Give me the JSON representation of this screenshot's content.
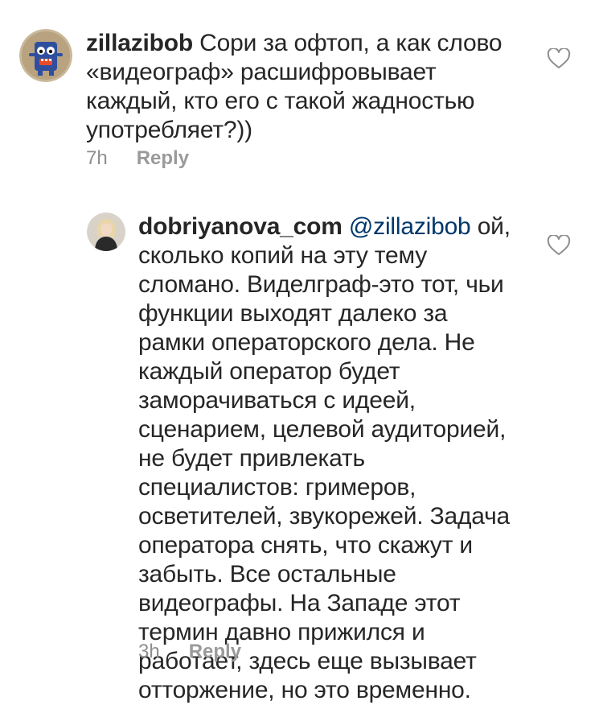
{
  "comments": [
    {
      "username": "zillazibob",
      "text": "Сори за офтоп, а как слово «видеограф» расшифровывает каждый, кто его с такой жадностью употребляет?))",
      "time": "7h",
      "reply_label": "Reply",
      "avatar_icon": "monster-avatar-icon",
      "like_icon": "heart-outline-icon"
    },
    {
      "username": "dobriyanova_com",
      "mention": "@zillazibob",
      "text": "ой, сколько копий на эту тему сломано. Виделграф-это тот, чьи функции выходят далеко за рамки операторского дела. Не каждый оператор будет заморачиваться с идеей, сценарием, целевой аудиторией, не будет привлекать специалистов: гримеров, осветителей, звукорежей. Задача оператора снять, что скажут и забыть. Все остальные видеографы. На Западе этот термин давно прижился и работает, здесь еще вызывает отторжение, но это временно.",
      "time": "3h",
      "reply_label": "Reply",
      "avatar_icon": "user-photo-avatar-icon",
      "like_icon": "heart-outline-icon"
    }
  ],
  "colors": {
    "text": "#262626",
    "meta": "#8e8e8e",
    "mention": "#00376b",
    "background": "#ffffff"
  }
}
